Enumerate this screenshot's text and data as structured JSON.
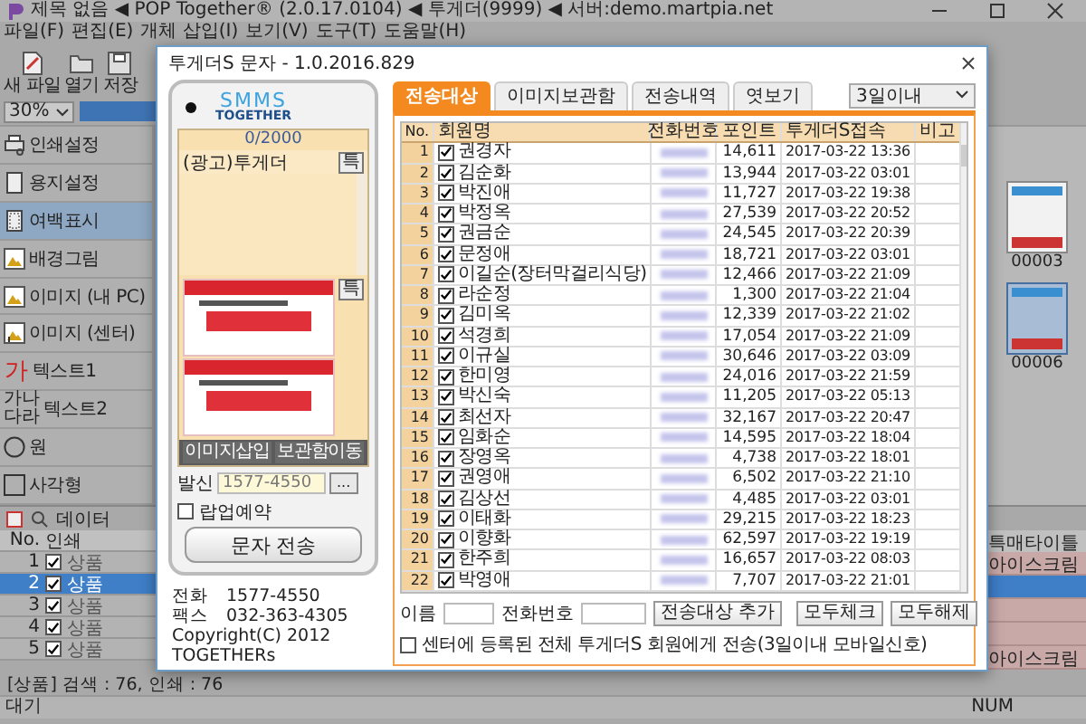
{
  "app": {
    "title": "제목 없음 ◀ POP Together® (2.0.17.0104) ◀ 투게더(9999) ◀ 서버:demo.martpia.net",
    "menu": [
      "파일(F)",
      "편집(E)",
      "개체 삽입(I)",
      "보기(V)",
      "도구(T)",
      "도움말(H)"
    ],
    "toolbar": [
      {
        "label": "새 파일",
        "kind": "new"
      },
      {
        "label": "열기",
        "kind": "open"
      },
      {
        "label": "저장",
        "kind": "save"
      }
    ],
    "zoom": "30%",
    "sidebar": [
      {
        "label": "인쇄설정",
        "kind": "printer",
        "selected": false
      },
      {
        "label": "용지설정",
        "kind": "page",
        "selected": false
      },
      {
        "label": "여백표시",
        "kind": "margin",
        "selected": true
      },
      {
        "label": "배경그림",
        "kind": "picture",
        "selected": false
      },
      {
        "label": "이미지 (내 PC)",
        "kind": "picture",
        "selected": false
      },
      {
        "label": "이미지 (센터)",
        "kind": "download",
        "selected": false
      },
      {
        "label": "텍스트1",
        "kind": "glyph",
        "glyph": "가",
        "selected": false
      },
      {
        "label": "텍스트2",
        "kind": "glyphs",
        "glyph": "가나다라",
        "selected": false
      },
      {
        "label": "원",
        "kind": "circle",
        "selected": false
      },
      {
        "label": "사각형",
        "kind": "rectangle",
        "selected": false
      }
    ],
    "thumbnails": [
      {
        "caption": "00003",
        "selected": false
      },
      {
        "caption": "00006",
        "selected": true
      }
    ],
    "data_grid": {
      "search": "데이터",
      "columns": [
        "No.",
        "인쇄"
      ],
      "rows": [
        {
          "no": "1",
          "checked": true,
          "item": "상품",
          "selected": false
        },
        {
          "no": "2",
          "checked": true,
          "item": "상품",
          "selected": true
        },
        {
          "no": "3",
          "checked": true,
          "item": "상품",
          "selected": false
        },
        {
          "no": "4",
          "checked": true,
          "item": "상품",
          "selected": false
        },
        {
          "no": "5",
          "checked": true,
          "item": "상품",
          "selected": false
        }
      ],
      "summary": "[상품] 검색 : 76, 인쇄 : 76"
    },
    "side_grid": {
      "column": "특매타이틀",
      "rows": [
        {
          "title": "아이스크림",
          "selected": false
        },
        {
          "selected": true
        },
        {
          "selected": false
        },
        {
          "selected": false
        },
        {
          "title": "아이스크림",
          "selected": false
        }
      ]
    },
    "status_bar": {
      "left": "대기",
      "right": "NUM"
    }
  },
  "dialog": {
    "title": "투게더S 문자 - 1.0.2016.829",
    "phone": {
      "logo": "SMMS",
      "logo_sub": "TOGETHER",
      "counter": "0/2000",
      "message": "(광고)투게더",
      "special_buttons": [
        "특",
        "특"
      ],
      "image_buttons": [
        "이미지삽입",
        "보관함이동"
      ],
      "sender_label": "발신",
      "sender": "1577-4550",
      "more": "...",
      "reserve": {
        "label": "랍업예약",
        "checked": false
      },
      "send": "문자 전송"
    },
    "contact": [
      {
        "label": "전화",
        "value": "1577-4550"
      },
      {
        "label": "팩스",
        "value": "032-363-4305"
      }
    ],
    "copyright": "Copyright(C) 2012 TOGETHERs",
    "tabs": [
      {
        "label": "전송대상",
        "selected": true
      },
      {
        "label": "이미지보관함",
        "selected": false
      },
      {
        "label": "전송내역",
        "selected": false
      },
      {
        "label": "엿보기",
        "selected": false
      }
    ],
    "period": "3일이내",
    "table": {
      "columns": [
        "No.",
        "회원명",
        "전화번호",
        "포인트",
        "투게더S접속",
        "비고"
      ],
      "rows": [
        {
          "no": "1",
          "checked": true,
          "name": "권경자",
          "points": "14,611",
          "last_access": "2017-03-22 13:36"
        },
        {
          "no": "2",
          "checked": true,
          "name": "김순화",
          "points": "13,944",
          "last_access": "2017-03-22 03:01"
        },
        {
          "no": "3",
          "checked": true,
          "name": "박진애",
          "points": "11,727",
          "last_access": "2017-03-22 19:38"
        },
        {
          "no": "4",
          "checked": true,
          "name": "박정옥",
          "points": "27,539",
          "last_access": "2017-03-22 20:52"
        },
        {
          "no": "5",
          "checked": true,
          "name": "권금순",
          "points": "24,545",
          "last_access": "2017-03-22 20:39"
        },
        {
          "no": "6",
          "checked": true,
          "name": "문정애",
          "points": "18,721",
          "last_access": "2017-03-22 03:01"
        },
        {
          "no": "7",
          "checked": true,
          "name": "이길순(장터막걸리식당)",
          "points": "12,466",
          "last_access": "2017-03-22 21:09"
        },
        {
          "no": "8",
          "checked": true,
          "name": "라순정",
          "points": "1,300",
          "last_access": "2017-03-22 21:04"
        },
        {
          "no": "9",
          "checked": true,
          "name": "김미옥",
          "points": "12,339",
          "last_access": "2017-03-22 21:02"
        },
        {
          "no": "10",
          "checked": true,
          "name": "석경희",
          "points": "17,054",
          "last_access": "2017-03-22 21:09"
        },
        {
          "no": "11",
          "checked": true,
          "name": "이규실",
          "points": "30,646",
          "last_access": "2017-03-22 03:09"
        },
        {
          "no": "12",
          "checked": true,
          "name": "한미영",
          "points": "24,016",
          "last_access": "2017-03-22 21:59"
        },
        {
          "no": "13",
          "checked": true,
          "name": "박신숙",
          "points": "11,205",
          "last_access": "2017-03-22 05:13"
        },
        {
          "no": "14",
          "checked": true,
          "name": "최선자",
          "points": "32,167",
          "last_access": "2017-03-22 20:47"
        },
        {
          "no": "15",
          "checked": true,
          "name": "임화순",
          "points": "14,595",
          "last_access": "2017-03-22 18:04"
        },
        {
          "no": "16",
          "checked": true,
          "name": "장영옥",
          "points": "4,738",
          "last_access": "2017-03-22 18:01"
        },
        {
          "no": "17",
          "checked": true,
          "name": "권영애",
          "points": "6,502",
          "last_access": "2017-03-22 21:10"
        },
        {
          "no": "18",
          "checked": true,
          "name": "김상선",
          "points": "4,485",
          "last_access": "2017-03-22 03:01"
        },
        {
          "no": "19",
          "checked": true,
          "name": "이태화",
          "points": "29,215",
          "last_access": "2017-03-22 18:23"
        },
        {
          "no": "20",
          "checked": true,
          "name": "이향화",
          "points": "62,597",
          "last_access": "2017-03-22 19:19"
        },
        {
          "no": "21",
          "checked": true,
          "name": "한주희",
          "points": "16,657",
          "last_access": "2017-03-22 08:03"
        },
        {
          "no": "22",
          "checked": true,
          "name": "박영애",
          "points": "7,707",
          "last_access": "2017-03-22 21:01"
        }
      ]
    },
    "add_form": {
      "name_label": "이름",
      "phone_label": "전화번호",
      "button": "전송대상 추가"
    },
    "all_members": {
      "label": "센터에 등록된 전체 투게더S 회원에게 전송(3일이내 모바일신호)",
      "checked": false
    },
    "buttons": [
      "모두체크",
      "모두해제"
    ]
  }
}
